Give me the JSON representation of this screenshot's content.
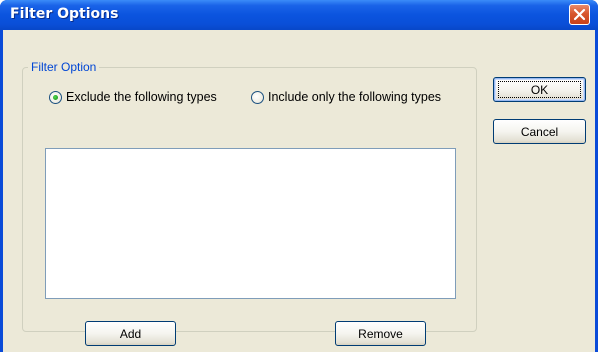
{
  "window": {
    "title": "Filter Options",
    "titlebar_color": "#0a4fd8",
    "close_icon": "close-icon"
  },
  "filter_group": {
    "legend": "Filter Option",
    "options": [
      {
        "label": "Exclude the following types",
        "selected": true
      },
      {
        "label": "Include only the following types",
        "selected": false
      }
    ],
    "types_list": [],
    "add_label": "Add",
    "remove_label": "Remove"
  },
  "dialog_buttons": {
    "ok_label": "OK",
    "cancel_label": "Cancel"
  }
}
